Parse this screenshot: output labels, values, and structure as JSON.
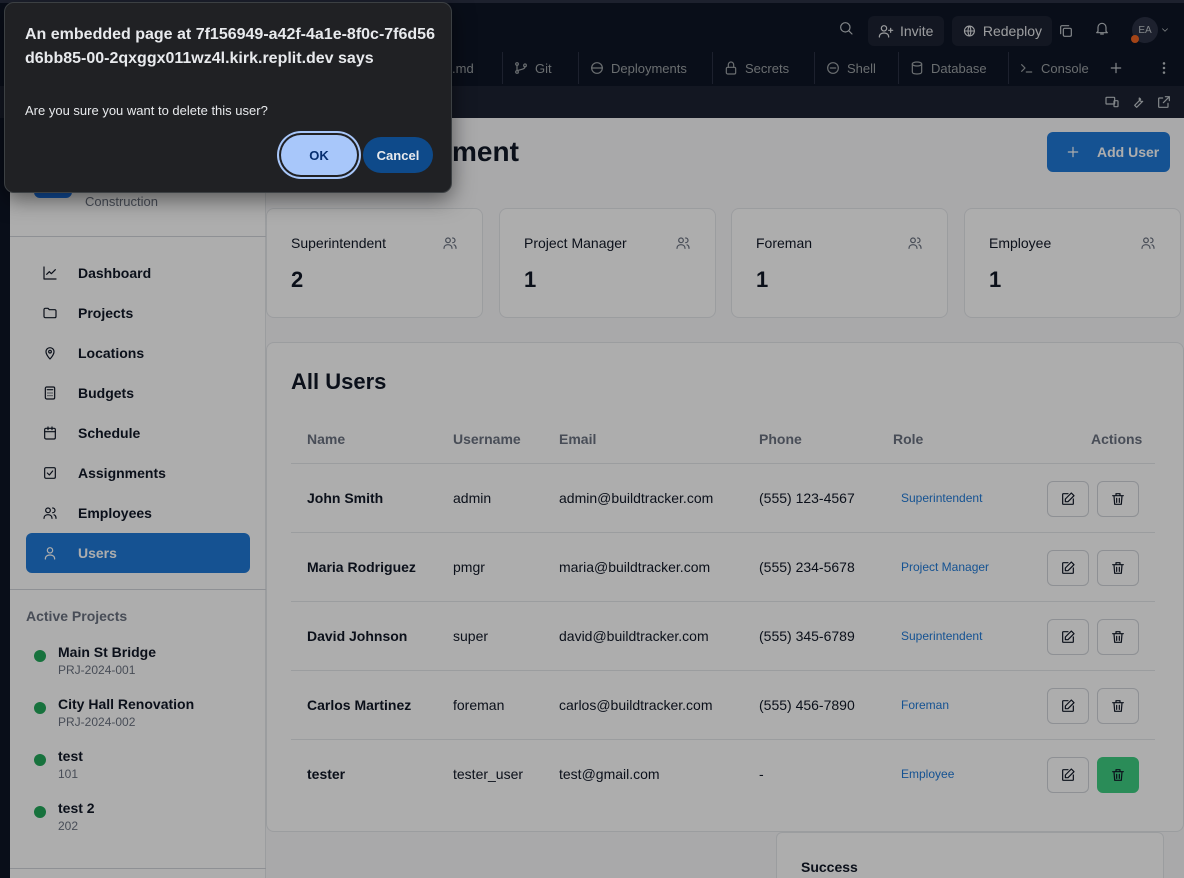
{
  "replit": {
    "invite_label": "Invite",
    "redeploy_label": "Redeploy",
    "avatar_initials": "EA",
    "notification_count": "1",
    "tabs": [
      {
        "label": ".md"
      },
      {
        "label": "Git"
      },
      {
        "label": "Deployments"
      },
      {
        "label": "Secrets"
      },
      {
        "label": "Shell"
      },
      {
        "label": "Database"
      },
      {
        "label": "Console"
      }
    ]
  },
  "sidebar": {
    "brand_subtitle": "Construction",
    "nav": [
      {
        "label": "Dashboard",
        "icon": "chart-line-icon"
      },
      {
        "label": "Projects",
        "icon": "folder-icon"
      },
      {
        "label": "Locations",
        "icon": "map-pin-icon"
      },
      {
        "label": "Budgets",
        "icon": "calculator-icon"
      },
      {
        "label": "Schedule",
        "icon": "calendar-icon"
      },
      {
        "label": "Assignments",
        "icon": "check-square-icon"
      },
      {
        "label": "Employees",
        "icon": "users-icon"
      },
      {
        "label": "Users",
        "icon": "user-icon",
        "active": true
      }
    ],
    "active_projects_title": "Active Projects",
    "projects": [
      {
        "name": "Main St Bridge",
        "code": "PRJ-2024-001"
      },
      {
        "name": "City Hall Renovation",
        "code": "PRJ-2024-002"
      },
      {
        "name": "test",
        "code": "101"
      },
      {
        "name": "test 2",
        "code": "202"
      }
    ]
  },
  "main": {
    "title_visible": "ment",
    "add_user_label": "Add User",
    "stats": [
      {
        "label": "Superintendent",
        "value": "2"
      },
      {
        "label": "Project Manager",
        "value": "1"
      },
      {
        "label": "Foreman",
        "value": "1"
      },
      {
        "label": "Employee",
        "value": "1"
      }
    ],
    "users_title": "All Users",
    "columns": [
      "Name",
      "Username",
      "Email",
      "Phone",
      "Role",
      "Actions"
    ],
    "rows": [
      {
        "name": "John Smith",
        "username": "admin",
        "email": "admin@buildtracker.com",
        "phone": "(555) 123-4567",
        "role": "Superintendent"
      },
      {
        "name": "Maria Rodriguez",
        "username": "pmgr",
        "email": "maria@buildtracker.com",
        "phone": "(555) 234-5678",
        "role": "Project Manager"
      },
      {
        "name": "David Johnson",
        "username": "super",
        "email": "david@buildtracker.com",
        "phone": "(555) 345-6789",
        "role": "Superintendent"
      },
      {
        "name": "Carlos Martinez",
        "username": "foreman",
        "email": "carlos@buildtracker.com",
        "phone": "(555) 456-7890",
        "role": "Foreman"
      },
      {
        "name": "tester",
        "username": "tester_user",
        "email": "test@gmail.com",
        "phone": "-",
        "role": "Employee"
      }
    ],
    "toast_title": "Success"
  },
  "dialog": {
    "title": "An embedded page at 7f156949-a42f-4a1e-8f0c-7f6d56d6bb85-00-2qxggx011wz4l.kirk.replit.dev says",
    "message": "Are you sure you want to delete this user?",
    "ok_label": "OK",
    "cancel_label": "Cancel"
  }
}
